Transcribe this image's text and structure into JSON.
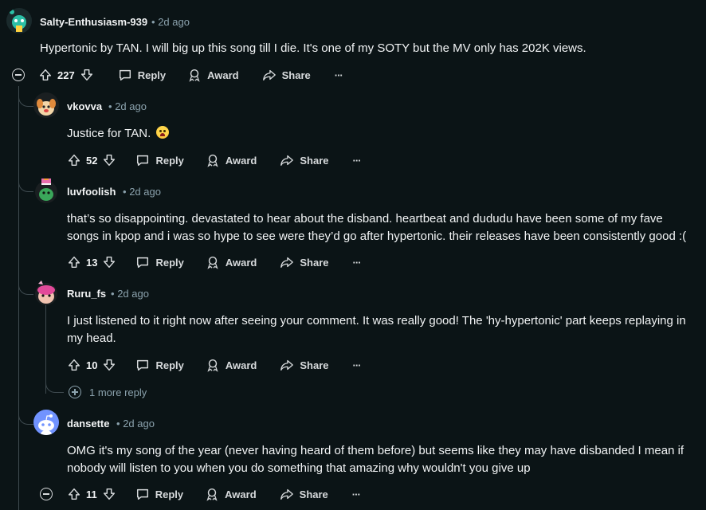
{
  "action_labels": {
    "reply": "Reply",
    "award": "Award",
    "share": "Share",
    "more": "···"
  },
  "separator": "•",
  "comments": [
    {
      "username": "Salty-Enthusiasm-939",
      "time": "2d ago",
      "body": "Hypertonic by TAN. I will big up this song till I die. It's one of my SOTY but the MV only has 202K views.",
      "votes": "227"
    },
    {
      "username": "vkovva",
      "time": "2d ago",
      "body": "Justice for TAN.",
      "votes": "52"
    },
    {
      "username": "luvfoolish",
      "time": "2d ago",
      "body": "that’s so disappointing. devastated to hear about the disband. heartbeat and dududu have been some of my fave songs in kpop and i was so hype to see were they’d go after hypertonic. their releases have been consistently good :(",
      "votes": "13"
    },
    {
      "username": "Ruru_fs",
      "time": "2d ago",
      "body": "I just listened to it right now after seeing your comment. It was really good! The 'hy-hypertonic' part keeps replaying in my head.",
      "votes": "10",
      "more_replies": "1 more reply"
    },
    {
      "username": "dansette",
      "time": "2d ago",
      "body": "OMG it's my song of the year (never having heard of them before) but seems like they may have disbanded I mean if nobody will listen to you when you do something that amazing why wouldn't you give up",
      "votes": "11"
    }
  ],
  "colors": {
    "background": "#0b1416",
    "text": "#f2f4f5",
    "muted": "#8ba2ad",
    "thread_line": "#3e4a4f"
  }
}
